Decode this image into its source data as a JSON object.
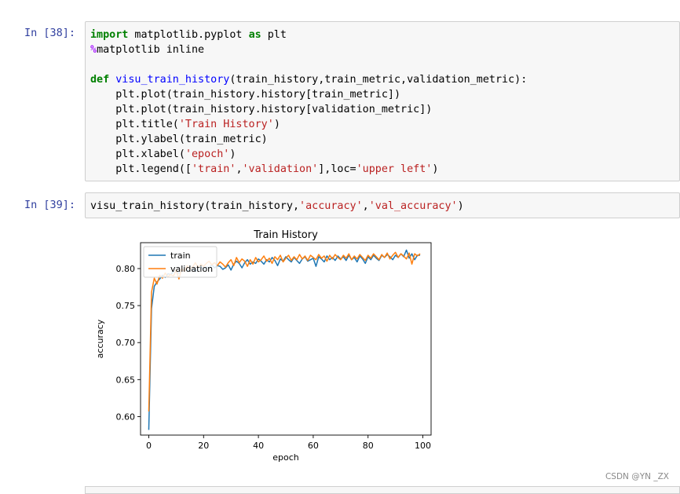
{
  "cells": [
    {
      "prompt": "In  [38]:",
      "code_lines": [
        [
          {
            "t": "import",
            "c": "kw"
          },
          {
            "t": " matplotlib.pyplot ",
            "c": ""
          },
          {
            "t": "as",
            "c": "kw"
          },
          {
            "t": " plt",
            "c": ""
          }
        ],
        [
          {
            "t": "%",
            "c": "mg"
          },
          {
            "t": "matplotlib inline",
            "c": ""
          }
        ],
        [],
        [
          {
            "t": "def",
            "c": "kw"
          },
          {
            "t": " ",
            "c": ""
          },
          {
            "t": "visu_train_history",
            "c": "fn"
          },
          {
            "t": "(train_history,train_metric,validation_metric):",
            "c": ""
          }
        ],
        [
          {
            "t": "    plt.plot(train_history.history[train_metric])",
            "c": ""
          }
        ],
        [
          {
            "t": "    plt.plot(train_history.history[validation_metric])",
            "c": ""
          }
        ],
        [
          {
            "t": "    plt.title(",
            "c": ""
          },
          {
            "t": "'Train History'",
            "c": "st"
          },
          {
            "t": ")",
            "c": ""
          }
        ],
        [
          {
            "t": "    plt.ylabel(train_metric)",
            "c": ""
          }
        ],
        [
          {
            "t": "    plt.xlabel(",
            "c": ""
          },
          {
            "t": "'epoch'",
            "c": "st"
          },
          {
            "t": ")",
            "c": ""
          }
        ],
        [
          {
            "t": "    plt.legend([",
            "c": ""
          },
          {
            "t": "'train'",
            "c": "st"
          },
          {
            "t": ",",
            "c": ""
          },
          {
            "t": "'validation'",
            "c": "st"
          },
          {
            "t": "],loc=",
            "c": ""
          },
          {
            "t": "'upper left'",
            "c": "st"
          },
          {
            "t": ")",
            "c": ""
          }
        ]
      ]
    },
    {
      "prompt": "In  [39]:",
      "code_lines": [
        [
          {
            "t": "visu_train_history(train_history,",
            "c": ""
          },
          {
            "t": "'accuracy'",
            "c": "st"
          },
          {
            "t": ",",
            "c": ""
          },
          {
            "t": "'val_accuracy'",
            "c": "st"
          },
          {
            "t": ")",
            "c": ""
          }
        ]
      ]
    }
  ],
  "chart_data": {
    "type": "line",
    "title": "Train History",
    "xlabel": "epoch",
    "ylabel": "accuracy",
    "xlim": [
      -3,
      103
    ],
    "ylim": [
      0.575,
      0.835
    ],
    "xticks": [
      0,
      20,
      40,
      60,
      80,
      100
    ],
    "yticks": [
      0.6,
      0.65,
      0.7,
      0.75,
      0.8
    ],
    "ytick_labels": [
      "0.60",
      "0.65",
      "0.70",
      "0.75",
      "0.80"
    ],
    "legend_position": "upper left",
    "grid": false,
    "series": [
      {
        "name": "train",
        "color": "#1f77b4",
        "values": [
          0.582,
          0.746,
          0.776,
          0.782,
          0.786,
          0.791,
          0.788,
          0.793,
          0.792,
          0.796,
          0.795,
          0.794,
          0.796,
          0.799,
          0.797,
          0.798,
          0.801,
          0.796,
          0.8,
          0.803,
          0.799,
          0.802,
          0.801,
          0.805,
          0.801,
          0.804,
          0.803,
          0.799,
          0.801,
          0.805,
          0.798,
          0.806,
          0.81,
          0.807,
          0.801,
          0.808,
          0.812,
          0.806,
          0.809,
          0.807,
          0.813,
          0.81,
          0.806,
          0.812,
          0.809,
          0.815,
          0.811,
          0.804,
          0.813,
          0.81,
          0.816,
          0.812,
          0.809,
          0.815,
          0.811,
          0.807,
          0.813,
          0.816,
          0.81,
          0.812,
          0.814,
          0.803,
          0.816,
          0.813,
          0.809,
          0.817,
          0.812,
          0.815,
          0.811,
          0.817,
          0.813,
          0.816,
          0.811,
          0.818,
          0.812,
          0.815,
          0.809,
          0.817,
          0.813,
          0.807,
          0.816,
          0.812,
          0.818,
          0.814,
          0.811,
          0.818,
          0.815,
          0.819,
          0.816,
          0.812,
          0.818,
          0.815,
          0.82,
          0.816,
          0.825,
          0.814,
          0.82,
          0.812,
          0.818,
          0.818
        ]
      },
      {
        "name": "validation",
        "color": "#ff7f0e",
        "values": [
          0.607,
          0.768,
          0.787,
          0.779,
          0.791,
          0.787,
          0.794,
          0.789,
          0.792,
          0.79,
          0.798,
          0.786,
          0.8,
          0.796,
          0.804,
          0.799,
          0.802,
          0.808,
          0.801,
          0.806,
          0.803,
          0.807,
          0.81,
          0.805,
          0.808,
          0.804,
          0.809,
          0.806,
          0.802,
          0.808,
          0.812,
          0.804,
          0.815,
          0.808,
          0.813,
          0.81,
          0.803,
          0.812,
          0.806,
          0.815,
          0.809,
          0.812,
          0.817,
          0.81,
          0.814,
          0.807,
          0.816,
          0.812,
          0.818,
          0.809,
          0.814,
          0.818,
          0.811,
          0.816,
          0.812,
          0.819,
          0.813,
          0.817,
          0.811,
          0.818,
          0.815,
          0.812,
          0.819,
          0.814,
          0.817,
          0.81,
          0.818,
          0.813,
          0.819,
          0.815,
          0.812,
          0.818,
          0.814,
          0.82,
          0.812,
          0.817,
          0.813,
          0.819,
          0.815,
          0.811,
          0.818,
          0.814,
          0.82,
          0.816,
          0.812,
          0.819,
          0.815,
          0.821,
          0.813,
          0.818,
          0.822,
          0.815,
          0.82,
          0.817,
          0.813,
          0.821,
          0.806,
          0.82,
          0.817,
          0.82
        ]
      }
    ]
  },
  "watermark": "CSDN @YN _ZX"
}
